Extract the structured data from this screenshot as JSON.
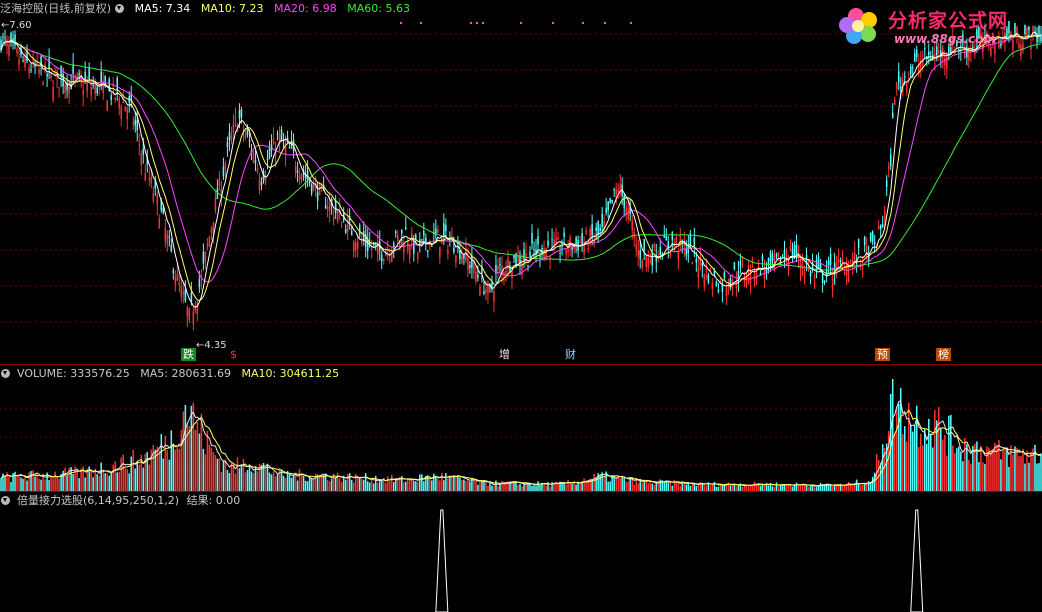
{
  "main_header": {
    "title": "泛海控股(日线,前复权)",
    "ma5": "MA5: 7.34",
    "ma10": "MA10: 7.23",
    "ma20": "MA20: 6.98",
    "ma60": "MA60: 5.63"
  },
  "price_labels": {
    "high": "7.60",
    "low": "4.35",
    "high_arrow": "←",
    "low_arrow": "←"
  },
  "markers": [
    "跌",
    "$",
    "增",
    "财",
    "预",
    "榜"
  ],
  "volume_header": {
    "volume": "VOLUME: 333576.25",
    "ma5": "MA5: 280631.69",
    "ma10": "MA10: 304611.25"
  },
  "indicator_header": {
    "name": "倍量接力选股(6,14,95,250,1,2)",
    "result": "结果: 0.00"
  },
  "logo": {
    "main": "分析家公式网",
    "url": "www.88gs.com"
  },
  "colors": {
    "up": "#ff3232",
    "down": "#54ffff",
    "ma5": "#ffffff",
    "ma10": "#ffff66",
    "ma20": "#ff44ff",
    "ma60": "#33ee33",
    "grid": "#6e0000",
    "signal": "#ffffff"
  },
  "chart_data": [
    {
      "type": "candlestick",
      "title": "泛海控股(日线,前复权)",
      "ylim": [
        4.35,
        7.6
      ],
      "anchors": [
        [
          0,
          7.45
        ],
        [
          12,
          7.2
        ],
        [
          25,
          7.05
        ],
        [
          38,
          7.0
        ],
        [
          48,
          6.95
        ],
        [
          58,
          6.85
        ],
        [
          65,
          6.7
        ],
        [
          72,
          6.1
        ],
        [
          80,
          5.6
        ],
        [
          88,
          4.9
        ],
        [
          94,
          4.5
        ],
        [
          100,
          4.9
        ],
        [
          106,
          5.6
        ],
        [
          112,
          6.15
        ],
        [
          118,
          6.65
        ],
        [
          124,
          6.35
        ],
        [
          130,
          6.0
        ],
        [
          138,
          6.4
        ],
        [
          145,
          6.25
        ],
        [
          152,
          6.0
        ],
        [
          160,
          5.8
        ],
        [
          168,
          5.6
        ],
        [
          176,
          5.4
        ],
        [
          184,
          5.25
        ],
        [
          190,
          5.2
        ],
        [
          196,
          5.3
        ],
        [
          202,
          5.4
        ],
        [
          208,
          5.2
        ],
        [
          212,
          5.3
        ],
        [
          218,
          5.35
        ],
        [
          226,
          5.3
        ],
        [
          232,
          5.15
        ],
        [
          238,
          4.95
        ],
        [
          244,
          4.75
        ],
        [
          248,
          5.0
        ],
        [
          254,
          5.1
        ],
        [
          262,
          5.15
        ],
        [
          270,
          5.25
        ],
        [
          280,
          5.25
        ],
        [
          290,
          5.3
        ],
        [
          300,
          5.4
        ],
        [
          308,
          5.9
        ],
        [
          312,
          5.7
        ],
        [
          318,
          5.2
        ],
        [
          324,
          5.15
        ],
        [
          330,
          5.25
        ],
        [
          336,
          5.3
        ],
        [
          342,
          5.25
        ],
        [
          348,
          5.1
        ],
        [
          354,
          4.95
        ],
        [
          360,
          4.85
        ],
        [
          366,
          4.95
        ],
        [
          372,
          5.0
        ],
        [
          378,
          5.05
        ],
        [
          384,
          5.0
        ],
        [
          388,
          5.1
        ],
        [
          394,
          5.2
        ],
        [
          400,
          5.1
        ],
        [
          406,
          4.95
        ],
        [
          412,
          4.95
        ],
        [
          418,
          5.05
        ],
        [
          424,
          5.1
        ],
        [
          430,
          5.15
        ],
        [
          436,
          5.25
        ],
        [
          440,
          5.5
        ],
        [
          444,
          6.2
        ],
        [
          446,
          6.9
        ],
        [
          452,
          7.1
        ],
        [
          460,
          7.25
        ],
        [
          468,
          7.3
        ],
        [
          476,
          7.4
        ],
        [
          482,
          7.35
        ],
        [
          490,
          7.45
        ],
        [
          500,
          7.5
        ]
      ],
      "series": [
        {
          "name": "MA5",
          "value": 7.34
        },
        {
          "name": "MA10",
          "value": 7.23
        },
        {
          "name": "MA20",
          "value": 6.98
        },
        {
          "name": "MA60",
          "value": 5.63
        }
      ],
      "annotations": [
        {
          "text": "7.60",
          "type": "high"
        },
        {
          "text": "4.35",
          "type": "low"
        }
      ]
    },
    {
      "type": "bar",
      "title": "VOLUME",
      "values_label": {
        "VOLUME": 333576.25,
        "MA5": 280631.69,
        "MA10": 304611.25
      },
      "anchors": [
        [
          0,
          0.12
        ],
        [
          40,
          0.16
        ],
        [
          70,
          0.28
        ],
        [
          85,
          0.45
        ],
        [
          92,
          0.75
        ],
        [
          97,
          0.62
        ],
        [
          105,
          0.35
        ],
        [
          115,
          0.2
        ],
        [
          125,
          0.26
        ],
        [
          140,
          0.14
        ],
        [
          160,
          0.14
        ],
        [
          175,
          0.12
        ],
        [
          200,
          0.1
        ],
        [
          220,
          0.13
        ],
        [
          240,
          0.07
        ],
        [
          280,
          0.06
        ],
        [
          300,
          0.13
        ],
        [
          320,
          0.08
        ],
        [
          350,
          0.06
        ],
        [
          380,
          0.06
        ],
        [
          420,
          0.05
        ],
        [
          435,
          0.1
        ],
        [
          445,
          0.8
        ],
        [
          450,
          0.7
        ],
        [
          458,
          0.62
        ],
        [
          466,
          0.6
        ],
        [
          480,
          0.4
        ],
        [
          500,
          0.33
        ]
      ]
    },
    {
      "type": "line",
      "title": "倍量接力选股(6,14,95,250,1,2)",
      "result": 0.0,
      "signals": [
        {
          "index": 220,
          "value": 1
        },
        {
          "index": 457,
          "value": 1
        }
      ]
    }
  ]
}
